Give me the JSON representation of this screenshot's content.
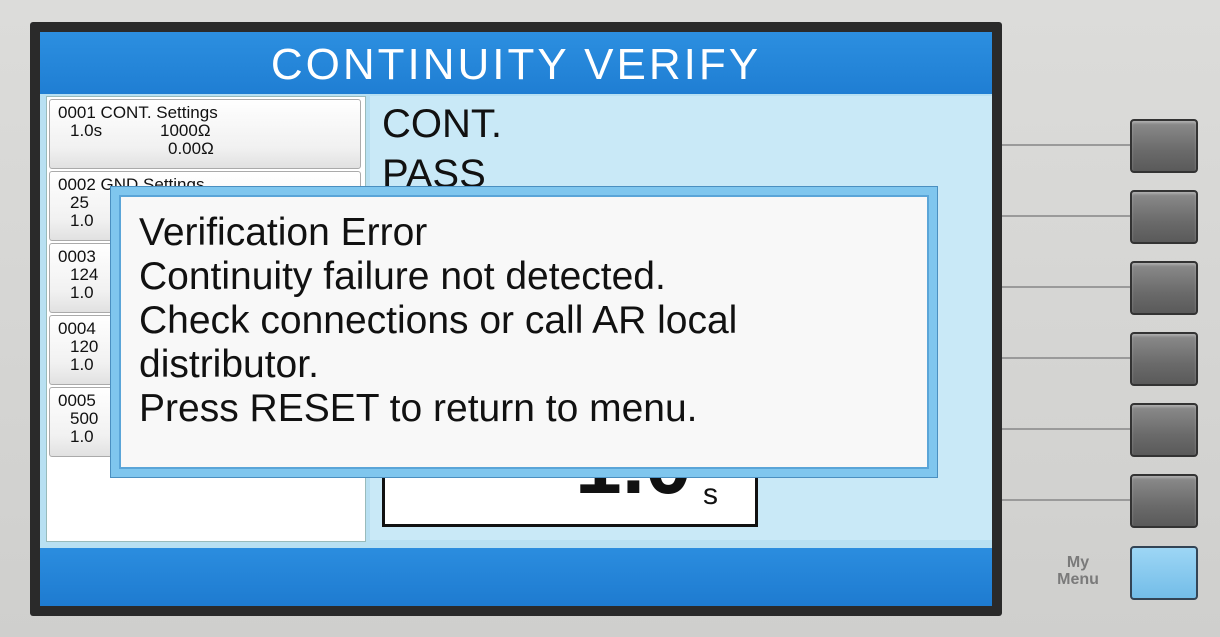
{
  "title": "CONTINUITY VERIFY",
  "test_list": [
    {
      "header": "0001 CONT. Settings",
      "time": "1.0s",
      "resistance": "1000Ω",
      "offset": "0.00Ω"
    },
    {
      "header": "0002 GND Settings",
      "line2": "25",
      "line3": "1.0"
    },
    {
      "header": "0003",
      "line2": "124",
      "line3": "1.0"
    },
    {
      "header": "0004",
      "line2": "120",
      "line3": "1.0"
    },
    {
      "header": "0005",
      "line2": "500",
      "line3": "1.0"
    }
  ],
  "right_panel": {
    "test_type": "CONT.",
    "status": "PASS",
    "timer_value": "1.0",
    "timer_unit": "s"
  },
  "dialog": {
    "lines": [
      "Verification Error",
      "Continuity failure not detected.",
      "Check connections or call AR local",
      "distributor.",
      "Press RESET to return to menu."
    ]
  },
  "hardware": {
    "my_menu_label_1": "My",
    "my_menu_label_2": "Menu"
  }
}
